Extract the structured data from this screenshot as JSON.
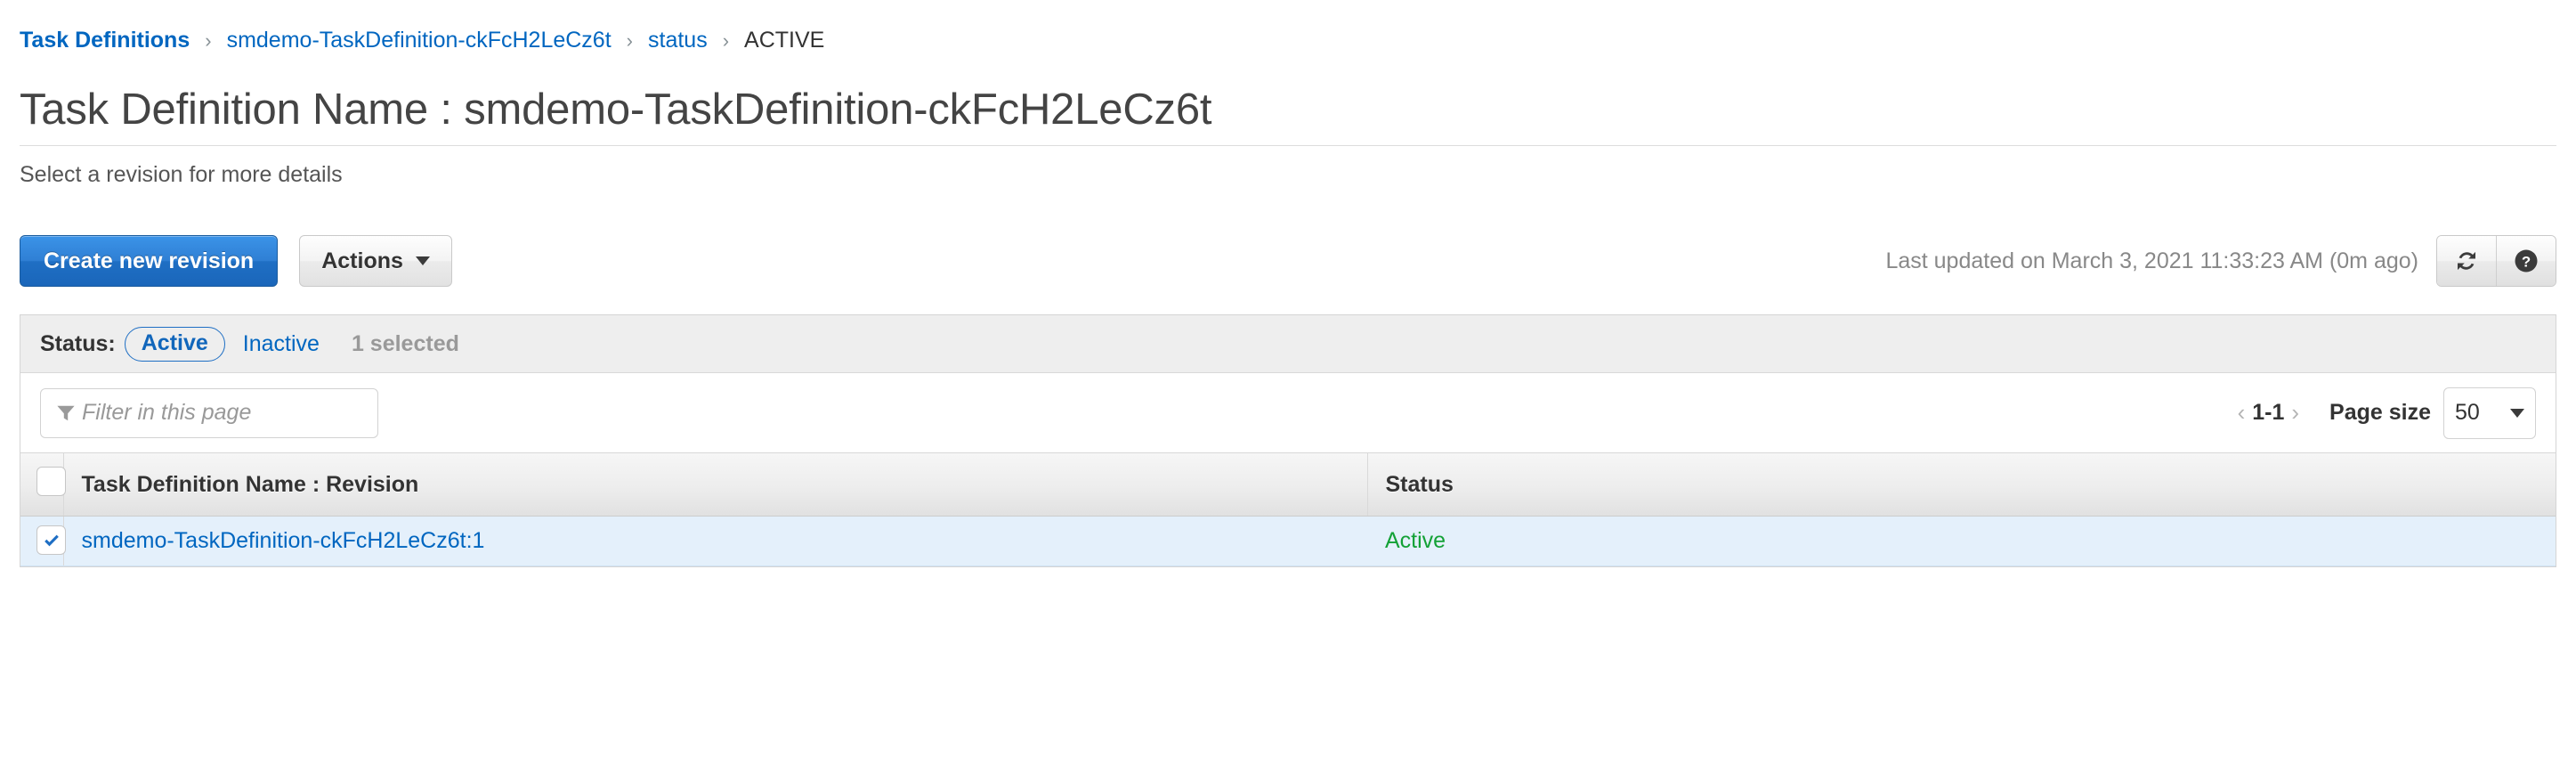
{
  "breadcrumb": [
    {
      "label": "Task Definitions",
      "link": true,
      "bold": true
    },
    {
      "label": "smdemo-TaskDefinition-ckFcH2LeCz6t",
      "link": true,
      "bold": false
    },
    {
      "label": "status",
      "link": true,
      "bold": false
    },
    {
      "label": "ACTIVE",
      "link": false,
      "bold": false
    }
  ],
  "breadcrumb_separator": "›",
  "page": {
    "title": "Task Definition Name : smdemo-TaskDefinition-ckFcH2LeCz6t",
    "subtitle": "Select a revision for more details"
  },
  "toolbar": {
    "create_label": "Create new revision",
    "actions_label": "Actions",
    "last_updated": "Last updated on March 3, 2021 11:33:23 AM (0m ago)",
    "refresh_icon": "refresh-icon",
    "help_icon": "help-icon"
  },
  "status_filter": {
    "label": "Status:",
    "active_label": "Active",
    "inactive_label": "Inactive",
    "selected_count": "1 selected"
  },
  "filter": {
    "placeholder": "Filter in this page",
    "value": "",
    "icon": "funnel-icon"
  },
  "pagination": {
    "prev_icon": "‹",
    "range": "1-1",
    "next_icon": "›",
    "page_size_label": "Page size",
    "page_size_value": "50"
  },
  "table": {
    "columns": [
      "Task Definition Name : Revision",
      "Status"
    ],
    "rows": [
      {
        "name": "smdemo-TaskDefinition-ckFcH2LeCz6t:1",
        "status": "Active",
        "checked": true
      }
    ]
  },
  "colors": {
    "link": "#0066c0",
    "primary_button": "#2f7fd4",
    "status_active": "#13a136",
    "row_selected_bg": "#e4f0fb"
  }
}
